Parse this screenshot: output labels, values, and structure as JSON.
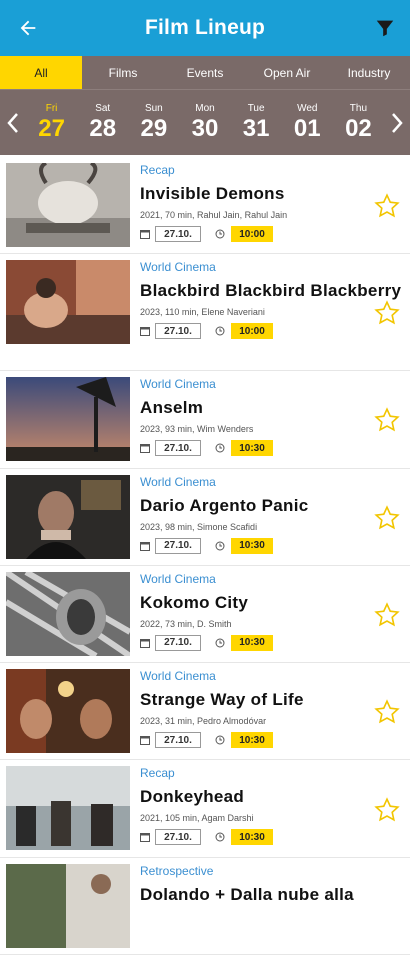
{
  "header": {
    "title": "Film Lineup"
  },
  "tabs": [
    {
      "label": "All"
    },
    {
      "label": "Films"
    },
    {
      "label": "Events"
    },
    {
      "label": "Open Air"
    },
    {
      "label": "Industry"
    }
  ],
  "dates": [
    {
      "dow": "Fri",
      "num": "27"
    },
    {
      "dow": "Sat",
      "num": "28"
    },
    {
      "dow": "Sun",
      "num": "29"
    },
    {
      "dow": "Mon",
      "num": "30"
    },
    {
      "dow": "Tue",
      "num": "31"
    },
    {
      "dow": "Wed",
      "num": "01"
    },
    {
      "dow": "Thu",
      "num": "02"
    }
  ],
  "films": [
    {
      "category": "Recap",
      "title": "Invisible Demons",
      "meta": "2021, 70 min, Rahul Jain, Rahul Jain",
      "date": "27.10.",
      "time": "10:00"
    },
    {
      "category": "World Cinema",
      "title": "Blackbird Blackbird Blackberry",
      "meta": "2023, 110 min, Elene Naveriani",
      "date": "27.10.",
      "time": "10:00"
    },
    {
      "category": "World Cinema",
      "title": "Anselm",
      "meta": "2023, 93 min, Wim Wenders",
      "date": "27.10.",
      "time": "10:30"
    },
    {
      "category": "World Cinema",
      "title": "Dario Argento Panic",
      "meta": "2023, 98 min, Simone Scafidi",
      "date": "27.10.",
      "time": "10:30"
    },
    {
      "category": "World Cinema",
      "title": "Kokomo City",
      "meta": "2022, 73 min, D. Smith",
      "date": "27.10.",
      "time": "10:30"
    },
    {
      "category": "World Cinema",
      "title": "Strange Way of Life",
      "meta": "2023, 31 min, Pedro Almodóvar",
      "date": "27.10.",
      "time": "10:30"
    },
    {
      "category": "Recap",
      "title": "Donkeyhead",
      "meta": "2021, 105 min, Agam Darshi",
      "date": "27.10.",
      "time": "10:30"
    },
    {
      "category": "Retrospective",
      "title": "Dolando + Dalla nube alla",
      "meta": "",
      "date": "",
      "time": ""
    }
  ],
  "colors": {
    "accent": "#1a9fd6",
    "highlight": "#ffd600",
    "bar": "#7a6a68",
    "category": "#3b8fd1"
  }
}
